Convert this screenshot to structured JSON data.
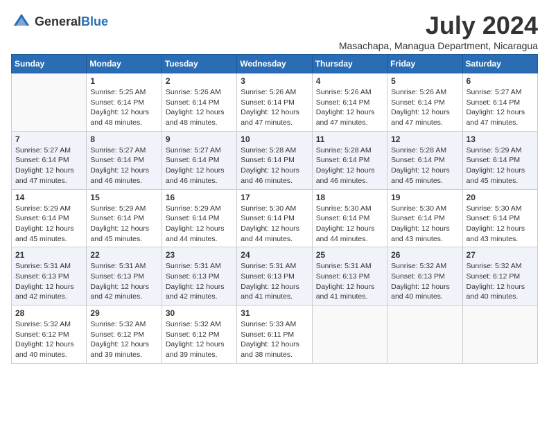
{
  "header": {
    "logo_general": "General",
    "logo_blue": "Blue",
    "month_year": "July 2024",
    "location": "Masachapa, Managua Department, Nicaragua"
  },
  "days_of_week": [
    "Sunday",
    "Monday",
    "Tuesday",
    "Wednesday",
    "Thursday",
    "Friday",
    "Saturday"
  ],
  "weeks": [
    [
      {
        "day": "",
        "detail": ""
      },
      {
        "day": "1",
        "detail": "Sunrise: 5:25 AM\nSunset: 6:14 PM\nDaylight: 12 hours\nand 48 minutes."
      },
      {
        "day": "2",
        "detail": "Sunrise: 5:26 AM\nSunset: 6:14 PM\nDaylight: 12 hours\nand 48 minutes."
      },
      {
        "day": "3",
        "detail": "Sunrise: 5:26 AM\nSunset: 6:14 PM\nDaylight: 12 hours\nand 47 minutes."
      },
      {
        "day": "4",
        "detail": "Sunrise: 5:26 AM\nSunset: 6:14 PM\nDaylight: 12 hours\nand 47 minutes."
      },
      {
        "day": "5",
        "detail": "Sunrise: 5:26 AM\nSunset: 6:14 PM\nDaylight: 12 hours\nand 47 minutes."
      },
      {
        "day": "6",
        "detail": "Sunrise: 5:27 AM\nSunset: 6:14 PM\nDaylight: 12 hours\nand 47 minutes."
      }
    ],
    [
      {
        "day": "7",
        "detail": "Sunrise: 5:27 AM\nSunset: 6:14 PM\nDaylight: 12 hours\nand 47 minutes."
      },
      {
        "day": "8",
        "detail": "Sunrise: 5:27 AM\nSunset: 6:14 PM\nDaylight: 12 hours\nand 46 minutes."
      },
      {
        "day": "9",
        "detail": "Sunrise: 5:27 AM\nSunset: 6:14 PM\nDaylight: 12 hours\nand 46 minutes."
      },
      {
        "day": "10",
        "detail": "Sunrise: 5:28 AM\nSunset: 6:14 PM\nDaylight: 12 hours\nand 46 minutes."
      },
      {
        "day": "11",
        "detail": "Sunrise: 5:28 AM\nSunset: 6:14 PM\nDaylight: 12 hours\nand 46 minutes."
      },
      {
        "day": "12",
        "detail": "Sunrise: 5:28 AM\nSunset: 6:14 PM\nDaylight: 12 hours\nand 45 minutes."
      },
      {
        "day": "13",
        "detail": "Sunrise: 5:29 AM\nSunset: 6:14 PM\nDaylight: 12 hours\nand 45 minutes."
      }
    ],
    [
      {
        "day": "14",
        "detail": "Sunrise: 5:29 AM\nSunset: 6:14 PM\nDaylight: 12 hours\nand 45 minutes."
      },
      {
        "day": "15",
        "detail": "Sunrise: 5:29 AM\nSunset: 6:14 PM\nDaylight: 12 hours\nand 45 minutes."
      },
      {
        "day": "16",
        "detail": "Sunrise: 5:29 AM\nSunset: 6:14 PM\nDaylight: 12 hours\nand 44 minutes."
      },
      {
        "day": "17",
        "detail": "Sunrise: 5:30 AM\nSunset: 6:14 PM\nDaylight: 12 hours\nand 44 minutes."
      },
      {
        "day": "18",
        "detail": "Sunrise: 5:30 AM\nSunset: 6:14 PM\nDaylight: 12 hours\nand 44 minutes."
      },
      {
        "day": "19",
        "detail": "Sunrise: 5:30 AM\nSunset: 6:14 PM\nDaylight: 12 hours\nand 43 minutes."
      },
      {
        "day": "20",
        "detail": "Sunrise: 5:30 AM\nSunset: 6:14 PM\nDaylight: 12 hours\nand 43 minutes."
      }
    ],
    [
      {
        "day": "21",
        "detail": "Sunrise: 5:31 AM\nSunset: 6:13 PM\nDaylight: 12 hours\nand 42 minutes."
      },
      {
        "day": "22",
        "detail": "Sunrise: 5:31 AM\nSunset: 6:13 PM\nDaylight: 12 hours\nand 42 minutes."
      },
      {
        "day": "23",
        "detail": "Sunrise: 5:31 AM\nSunset: 6:13 PM\nDaylight: 12 hours\nand 42 minutes."
      },
      {
        "day": "24",
        "detail": "Sunrise: 5:31 AM\nSunset: 6:13 PM\nDaylight: 12 hours\nand 41 minutes."
      },
      {
        "day": "25",
        "detail": "Sunrise: 5:31 AM\nSunset: 6:13 PM\nDaylight: 12 hours\nand 41 minutes."
      },
      {
        "day": "26",
        "detail": "Sunrise: 5:32 AM\nSunset: 6:13 PM\nDaylight: 12 hours\nand 40 minutes."
      },
      {
        "day": "27",
        "detail": "Sunrise: 5:32 AM\nSunset: 6:12 PM\nDaylight: 12 hours\nand 40 minutes."
      }
    ],
    [
      {
        "day": "28",
        "detail": "Sunrise: 5:32 AM\nSunset: 6:12 PM\nDaylight: 12 hours\nand 40 minutes."
      },
      {
        "day": "29",
        "detail": "Sunrise: 5:32 AM\nSunset: 6:12 PM\nDaylight: 12 hours\nand 39 minutes."
      },
      {
        "day": "30",
        "detail": "Sunrise: 5:32 AM\nSunset: 6:12 PM\nDaylight: 12 hours\nand 39 minutes."
      },
      {
        "day": "31",
        "detail": "Sunrise: 5:33 AM\nSunset: 6:11 PM\nDaylight: 12 hours\nand 38 minutes."
      },
      {
        "day": "",
        "detail": ""
      },
      {
        "day": "",
        "detail": ""
      },
      {
        "day": "",
        "detail": ""
      }
    ]
  ]
}
